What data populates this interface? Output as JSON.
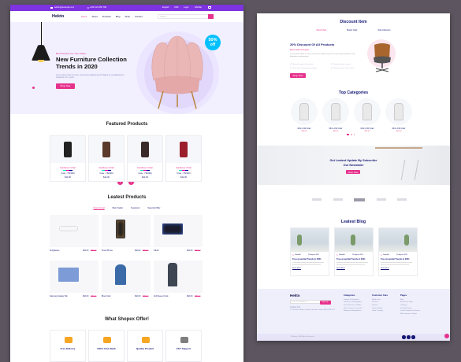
{
  "topbar": {
    "email": "admin@example.com",
    "phone": "+000 123 456 789",
    "lang": "English",
    "currency": "USD",
    "login": "Login",
    "wishlist": "Wishlist"
  },
  "nav": {
    "logo": "Hekto",
    "items": [
      "Home",
      "About",
      "Products",
      "Blog",
      "Shop",
      "Contact"
    ],
    "search_placeholder": "Search..."
  },
  "hero": {
    "kicker": "Best Furniture For Your Castle....",
    "title_line1": "New Furniture Collection",
    "title_line2": "Trends in 2020",
    "desc": "Lorem ipsum dolor sit amet, consectetur adipiscing elit. Magna in est adipiscing in phasellus non in justo.",
    "cta": "Shop Now",
    "badge_pct": "50%",
    "badge_off": "off"
  },
  "featured": {
    "title": "Featured Products",
    "products": [
      {
        "name": "Cantilever Chair",
        "code": "Code - Y523201",
        "price": "$42.00"
      },
      {
        "name": "Cantilever Chair",
        "code": "Code - Y523201",
        "price": "$42.00"
      },
      {
        "name": "Cantilever Chair",
        "code": "Code - Y523201",
        "price": "$42.00"
      },
      {
        "name": "Cantilever Chair",
        "code": "Code - Y523201",
        "price": "$42.00"
      }
    ]
  },
  "latest": {
    "title": "Leatest Products",
    "tabs": [
      "New Arrival",
      "Best Seller",
      "Featured",
      "Special Offer"
    ],
    "products": [
      {
        "name": "Sunglasses",
        "price": "$42.00",
        "old": "$65.00"
      },
      {
        "name": "Smart Phone",
        "price": "$42.00",
        "old": "$65.00"
      },
      {
        "name": "Tablet",
        "price": "$42.00",
        "old": "$65.00"
      },
      {
        "name": "Samsung Galaxy Tab",
        "price": "$42.00",
        "old": "$65.00"
      },
      {
        "name": "Blue Frock",
        "price": "$42.00",
        "old": "$65.00"
      },
      {
        "name": "Full Sleeve Frock",
        "price": "$42.00",
        "old": "$65.00"
      }
    ]
  },
  "offer": {
    "title": "What Shopex Offer!",
    "items": [
      {
        "title": "Free Delivery",
        "icon": "truck-icon"
      },
      {
        "title": "100% Cash Back",
        "icon": "cashback-icon"
      },
      {
        "title": "Quality Product",
        "icon": "quality-icon"
      },
      {
        "title": "24/7 Support",
        "icon": "support-icon"
      }
    ]
  },
  "discount": {
    "title": "Discount Item",
    "tabs": [
      "Wood Chair",
      "Plastic Chair",
      "Sofa Collection"
    ],
    "heading": "20% Discount Of All Products",
    "sub": "Eams Sofa Compact",
    "desc": "Lorem ipsum dolor sit amet, consectetur adipiscing elit. Eu eget feugiat habitasse nec, bibendum condimentum.",
    "features": [
      "Material expose like metals",
      "Simple neutral colours.",
      "Clear lines and geomatric figures",
      "Material expose like metals"
    ],
    "cta": "Shop Now"
  },
  "categories": {
    "title": "Top Categories",
    "items": [
      {
        "name": "Mini LCW Chair",
        "price": "$56.00"
      },
      {
        "name": "Mini LCW Chair",
        "price": "$56.00"
      },
      {
        "name": "Mini LCW Chair",
        "price": "$56.00"
      },
      {
        "name": "Mini LCW Chair",
        "price": "$56.00"
      }
    ]
  },
  "newsletter": {
    "line1": "Get Leatest Update By Subscribe",
    "line2": "Our Newslater",
    "cta": "Shop Now"
  },
  "blog": {
    "title": "Leatest Blog",
    "posts": [
      {
        "author": "SaberAli",
        "date": "21 August,2020",
        "title": "Top esssential Trends in 2021",
        "link": "Read More"
      },
      {
        "author": "SaberAli",
        "date": "21 August,2020",
        "title": "Top esssential Trends in 2021",
        "link": "Read More"
      },
      {
        "author": "SaberAli",
        "date": "21 August,2020",
        "title": "Top esssential Trends in 2021",
        "link": "Read More"
      }
    ]
  },
  "footer": {
    "logo": "Hekto",
    "email_placeholder": "Enter Email Address",
    "signup": "Sign Up",
    "contact": "Contact Info",
    "address": "17 Princess Road, London, Greater London NW1 8JR, UK",
    "cols": [
      {
        "title": "Catagories",
        "links": [
          "Laptops & Computers",
          "Cameras & Photography",
          "Smart Phones & Tablets",
          "Video Games & Consoles",
          "Waterproof Headphones"
        ]
      },
      {
        "title": "Customer Care",
        "links": [
          "My Account",
          "Discount",
          "Returns",
          "Orders History",
          "Order Tracking"
        ]
      },
      {
        "title": "Pages",
        "links": [
          "Blog",
          "Browse the Shop",
          "Category",
          "Pre-Built Pages",
          "Visual Composer Elements",
          "WooCommerce Pages"
        ]
      }
    ],
    "copyright": "©Webecy - All Rights Reserved"
  },
  "colors": {
    "accent": "#e6328c",
    "navy": "#151875",
    "purple": "#7e33e0",
    "hero_bg": "#f2f0ff"
  }
}
